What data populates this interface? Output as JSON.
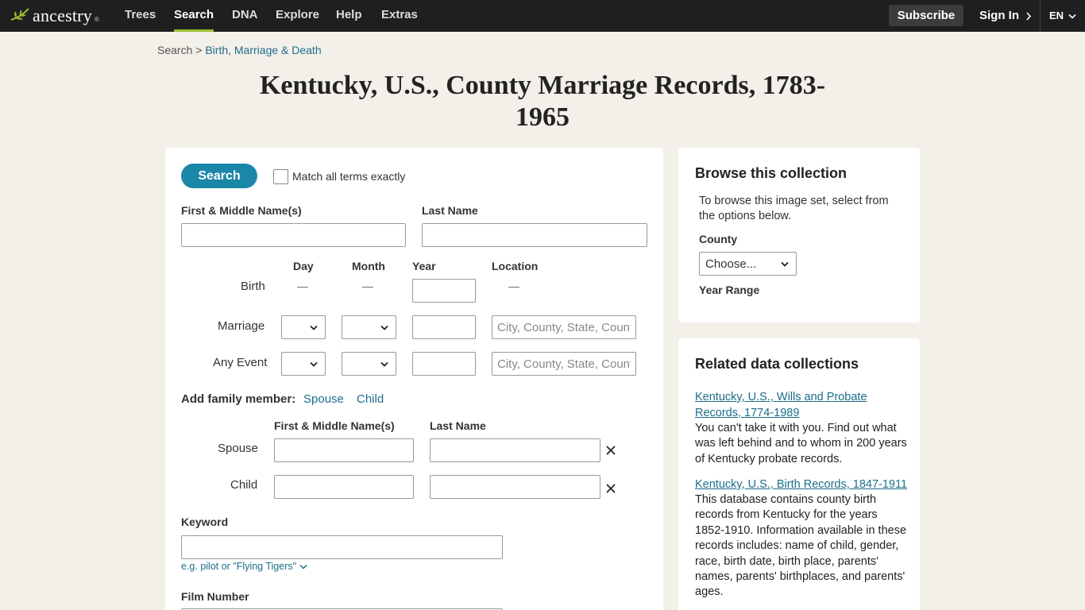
{
  "nav": {
    "logo": "ancestry",
    "logo_tm": "®",
    "items": [
      "Trees",
      "Search",
      "DNA",
      "Explore",
      "Help",
      "Extras"
    ],
    "subscribe": "Subscribe",
    "sign_in": "Sign In",
    "lang": "EN",
    "accent_color": "#9cbe30"
  },
  "breadcrumb": {
    "root": "Search",
    "sep": " > ",
    "current": "Birth, Marriage & Death"
  },
  "title_line1": "Kentucky, U.S., County Marriage Records, 1783-",
  "title_line2": "1965",
  "search": {
    "button": "Search",
    "match_exact": "Match all terms exactly",
    "first_name_label": "First & Middle Name(s)",
    "last_name_label": "Last Name",
    "col_day": "Day",
    "col_month": "Month",
    "col_year": "Year",
    "col_location": "Location",
    "row_birth": "Birth",
    "row_marriage": "Marriage",
    "row_any": "Any Event",
    "dash": "—",
    "location_placeholder": "City, County, State, Country",
    "family_label": "Add family member:",
    "family_spouse_link": "Spouse",
    "family_child_link": "Child",
    "fam_first_label": "First & Middle Name(s)",
    "fam_last_label": "Last Name",
    "fam_spouse": "Spouse",
    "fam_child": "Child",
    "keyword_label": "Keyword",
    "keyword_hint": "e.g. pilot or \"Flying Tigers\"",
    "film_label": "Film Number"
  },
  "browse": {
    "title": "Browse this collection",
    "text": "To browse this image set, select from the options below.",
    "county_label": "County",
    "county_value": "Choose...",
    "year_label": "Year Range"
  },
  "related": {
    "title": "Related data collections",
    "items": [
      {
        "link": "Kentucky, U.S., Wills and Probate Records, 1774-1989",
        "desc": "You can't take it with you. Find out what was left behind and to whom in 200 years of Kentucky probate records."
      },
      {
        "link": "Kentucky, U.S., Birth Records, 1847-1911",
        "desc": "This database contains county birth records from Kentucky for the years 1852-1910. Information available in these records includes: name of child, gender, race, birth date, birth place, parents' names, parents' birthplaces, and parents' ages."
      }
    ]
  }
}
